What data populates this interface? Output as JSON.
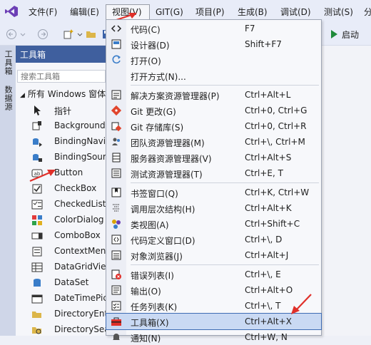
{
  "menubar": {
    "items": [
      "文件(F)",
      "编辑(E)",
      "视图(V)",
      "GIT(G)",
      "项目(P)",
      "生成(B)",
      "调试(D)",
      "测试(S)",
      "分"
    ]
  },
  "toolbar": {
    "start_label": "启动"
  },
  "side_tabs": [
    "工具箱",
    "数据源"
  ],
  "toolbox": {
    "title": "工具箱",
    "search_placeholder": "搜索工具箱",
    "group": "所有 Windows 窗体",
    "items": [
      "指针",
      "Background",
      "BindingNavi",
      "BindingSour",
      "Button",
      "CheckBox",
      "CheckedList",
      "ColorDialog",
      "ComboBox",
      "ContextMen",
      "DataGridView",
      "DataSet",
      "DateTimePic",
      "DirectoryEnt",
      "DirectorySea"
    ]
  },
  "view_menu": {
    "items": [
      {
        "label": "代码(C)",
        "shortcut": "F7"
      },
      {
        "label": "设计器(D)",
        "shortcut": "Shift+F7"
      },
      {
        "label": "打开(O)",
        "shortcut": ""
      },
      {
        "label": "打开方式(N)...",
        "shortcut": ""
      },
      {
        "label": "解决方案资源管理器(P)",
        "shortcut": "Ctrl+Alt+L"
      },
      {
        "label": "Git 更改(G)",
        "shortcut": "Ctrl+0, Ctrl+G"
      },
      {
        "label": "Git 存储库(S)",
        "shortcut": "Ctrl+0, Ctrl+R"
      },
      {
        "label": "团队资源管理器(M)",
        "shortcut": "Ctrl+\\, Ctrl+M"
      },
      {
        "label": "服务器资源管理器(V)",
        "shortcut": "Ctrl+Alt+S"
      },
      {
        "label": "测试资源管理器(T)",
        "shortcut": "Ctrl+E, T"
      },
      {
        "label": "书签窗口(Q)",
        "shortcut": "Ctrl+K, Ctrl+W"
      },
      {
        "label": "调用层次结构(H)",
        "shortcut": "Ctrl+Alt+K"
      },
      {
        "label": "类视图(A)",
        "shortcut": "Ctrl+Shift+C"
      },
      {
        "label": "代码定义窗口(D)",
        "shortcut": "Ctrl+\\, D"
      },
      {
        "label": "对象浏览器(J)",
        "shortcut": "Ctrl+Alt+J"
      },
      {
        "label": "错误列表(I)",
        "shortcut": "Ctrl+\\, E"
      },
      {
        "label": "输出(O)",
        "shortcut": "Ctrl+Alt+O"
      },
      {
        "label": "任务列表(K)",
        "shortcut": "Ctrl+\\, T"
      },
      {
        "label": "工具箱(X)",
        "shortcut": "Ctrl+Alt+X"
      },
      {
        "label": "通知(N)",
        "shortcut": "Ctrl+W, N"
      }
    ],
    "highlighted_index": 18
  },
  "colors": {
    "accent": "#3f5f9e",
    "highlight": "#c9d9f3",
    "annotation_arrow": "#e0302a",
    "vs_purple": "#6c3fb5"
  }
}
